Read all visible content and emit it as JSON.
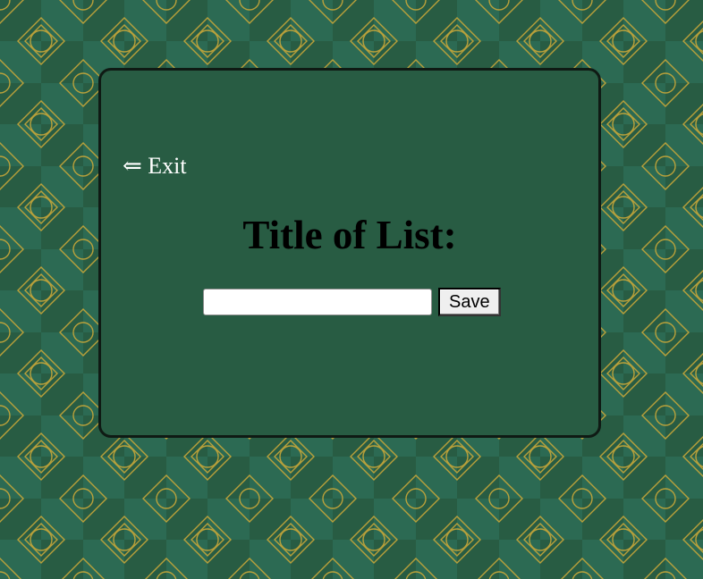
{
  "background": {
    "base_color": "#2c6a53",
    "dark_tile_color": "#285c43",
    "line_color": "#c9a838",
    "pattern_icon": "diamond-circle-pattern"
  },
  "dialog": {
    "panel_color": "#285c43",
    "border_color": "#0f1a14",
    "exit_link": {
      "arrow": "⇐",
      "label": "Exit"
    },
    "title": "Title of List:",
    "title_input": {
      "value": "",
      "placeholder": ""
    },
    "save_label": "Save"
  }
}
